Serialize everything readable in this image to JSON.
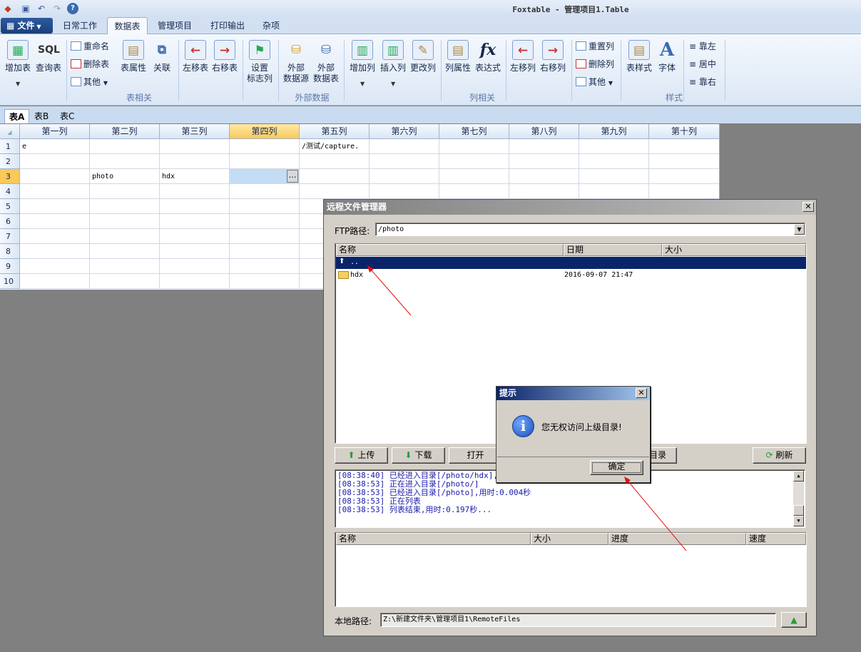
{
  "app_title": "Foxtable - 管理项目1.Table",
  "menu": {
    "file": "文件",
    "tabs": [
      "日常工作",
      "数据表",
      "管理项目",
      "打印输出",
      "杂项"
    ]
  },
  "ribbon": {
    "add_table": "增加表",
    "query_table": "查询表",
    "rename": "重命名",
    "delete_table": "删除表",
    "other": "其他",
    "table_props": "表属性",
    "relation": "关联",
    "move_left_table": "左移表",
    "move_right_table": "右移表",
    "set_flag_col_1": "设置",
    "set_flag_col_2": "标志列",
    "ext_source_1": "外部",
    "ext_source_2": "数据源",
    "ext_table_1": "外部",
    "ext_table_2": "数据表",
    "add_col": "增加列",
    "insert_col": "插入列",
    "change_col": "更改列",
    "col_props": "列属性",
    "expression": "表达式",
    "move_left_col": "左移列",
    "move_right_col": "右移列",
    "reset_col": "重置列",
    "delete_col": "删除列",
    "other2": "其他",
    "table_style": "表样式",
    "font": "字体",
    "align_left": "靠左",
    "align_center": "居中",
    "align_right": "靠右",
    "groups": {
      "table": "表相关",
      "external": "外部数据",
      "column": "列相关",
      "style": "样式"
    }
  },
  "sheet_tabs": [
    "表A",
    "表B",
    "表C"
  ],
  "grid": {
    "columns": [
      "第一列",
      "第二列",
      "第三列",
      "第四列",
      "第五列",
      "第六列",
      "第七列",
      "第八列",
      "第九列",
      "第十列"
    ],
    "row_numbers": [
      "1",
      "2",
      "3",
      "4",
      "5",
      "6",
      "7",
      "8",
      "9",
      "10"
    ],
    "cells": {
      "r1c1": "e",
      "r1c5": "/测试/capture.",
      "r3c2": "photo",
      "r3c3": "hdx"
    },
    "cell_button": "…"
  },
  "remote_dialog": {
    "title": "远程文件管理器",
    "ftp_label": "FTP路径:",
    "ftp_path": "/photo",
    "list_headers": [
      "名称",
      "日期",
      "大小"
    ],
    "items": [
      {
        "name": "..",
        "date": ""
      },
      {
        "name": "hdx",
        "date": "2016-09-07 21:47"
      }
    ],
    "buttons": {
      "upload": "上传",
      "download": "下载",
      "open": "打开",
      "dir": "目录",
      "refresh": "刷新"
    },
    "log": [
      "[08:38:40] 已经进入目录[/photo/hdx],用",
      "[08:38:53] 正在进入目录[/photo/]",
      "[08:38:53] 已经进入目录[/photo],用时:0.004秒",
      "[08:38:53] 正在列表",
      "[08:38:53] 列表结束,用时:0.197秒..."
    ],
    "transfer_headers": [
      "名称",
      "大小",
      "进度",
      "速度"
    ],
    "local_label": "本地路径:",
    "local_path": "Z:\\新建文件夹\\管理项目1\\RemoteFiles"
  },
  "alert": {
    "title": "提示",
    "message": "您无权访问上级目录!",
    "ok": "确定"
  },
  "colors": {
    "selection": "#0a246a",
    "log_text": "#1a1aa8",
    "annotation": "#e01010"
  }
}
